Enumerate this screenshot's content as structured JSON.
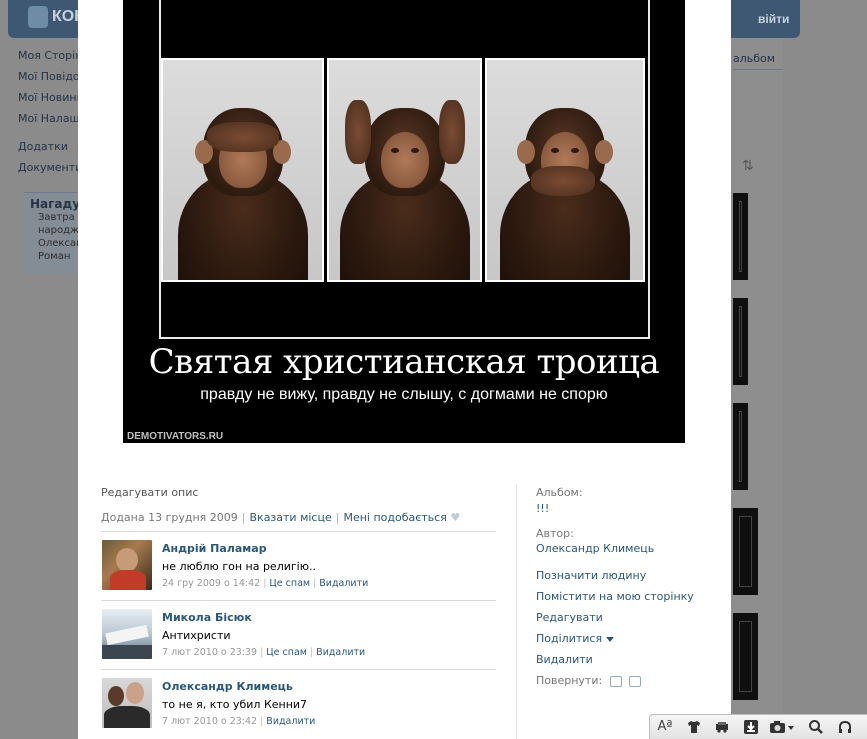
{
  "background": {
    "logo_text": "КОН",
    "login_label": "війти",
    "left_menu": [
      "Моя Сторінка",
      "Мої Повідомлення",
      "Мої Новини",
      "Мої Налаштування"
    ],
    "left_menu_extra": [
      "Додатки",
      "Документи"
    ],
    "reminder_title": "Нагадування",
    "reminder_lines": [
      "Завтра",
      "народження",
      "Олександр",
      "Роман"
    ],
    "album_link": "альбом",
    "sort_icon": "sort-arrows-icon"
  },
  "photo": {
    "title": "Святая христианская троица",
    "subtitle": "правду не вижу, правду не слышу, с догмами не спорю",
    "watermark": "DEMOTIVATORS.RU"
  },
  "info": {
    "edit_description": "Редагувати опис",
    "added_text": "Додана 13 грудня 2009",
    "show_place": "Вказати місце",
    "like": "Мені подобається"
  },
  "comments": [
    {
      "author": "Андрій Паламар",
      "text": "не люблю гон на религію..",
      "date": "24 гру 2009 о 14:42",
      "spam": "Це спам",
      "delete": "Видалити"
    },
    {
      "author": "Микола Бісюк",
      "text": "Антихристи",
      "date": "7 лют 2010 о 23:39",
      "spam": "Це спам",
      "delete": "Видалити"
    },
    {
      "author": "Олександр Климець",
      "text": "то не я, кто убил Кенни7",
      "date": "7 лют 2010 о 23:42",
      "delete": "Видалити"
    }
  ],
  "sidebar": {
    "album_label": "Альбом:",
    "album_value": "!!!",
    "author_label": "Автор:",
    "author_value": "Олександр Климець",
    "actions": [
      "Позначити людину",
      "Помістити на мою сторінку",
      "Редагувати",
      "Поділитися",
      "Видалити"
    ],
    "rotate_label": "Повернути:"
  },
  "addon_bar": {
    "icons": [
      "font-size-icon",
      "shirt-icon",
      "car-icon",
      "download-icon",
      "camera-icon",
      "search-icon",
      "headphones-icon"
    ],
    "font_glyph": "Aª"
  },
  "colors": {
    "link": "#2b587a",
    "header": "#3e5873",
    "muted": "#777777"
  }
}
